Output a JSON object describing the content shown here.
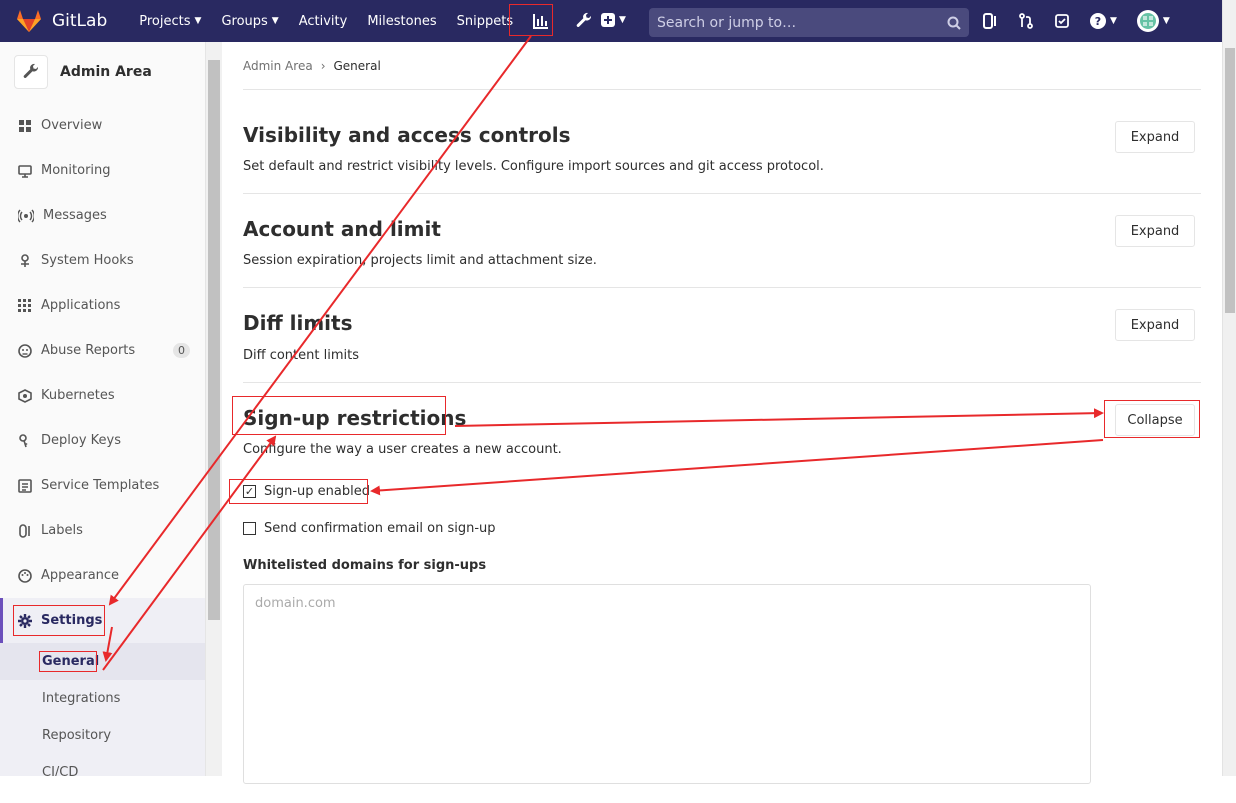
{
  "topbar": {
    "brand": "GitLab",
    "nav": [
      "Projects",
      "Groups",
      "Activity",
      "Milestones",
      "Snippets"
    ],
    "search_placeholder": "Search or jump to…",
    "bg_color": "#292961"
  },
  "sidebar": {
    "title": "Admin Area",
    "items": [
      {
        "label": "Overview",
        "icon": "overview-icon"
      },
      {
        "label": "Monitoring",
        "icon": "monitor-icon"
      },
      {
        "label": "Messages",
        "icon": "broadcast-icon"
      },
      {
        "label": "System Hooks",
        "icon": "hook-icon"
      },
      {
        "label": "Applications",
        "icon": "grid-icon"
      },
      {
        "label": "Abuse Reports",
        "icon": "abuse-icon",
        "badge": "0"
      },
      {
        "label": "Kubernetes",
        "icon": "kubernetes-icon"
      },
      {
        "label": "Deploy Keys",
        "icon": "key-icon"
      },
      {
        "label": "Service Templates",
        "icon": "template-icon"
      },
      {
        "label": "Labels",
        "icon": "label-icon"
      },
      {
        "label": "Appearance",
        "icon": "palette-icon"
      },
      {
        "label": "Settings",
        "icon": "gear-icon"
      }
    ],
    "sub_items": [
      "General",
      "Integrations",
      "Repository",
      "CI/CD"
    ]
  },
  "breadcrumb": {
    "parent": "Admin Area",
    "current": "General"
  },
  "sections": [
    {
      "title": "Visibility and access controls",
      "desc": "Set default and restrict visibility levels. Configure import sources and git access protocol.",
      "button": "Expand"
    },
    {
      "title": "Account and limit",
      "desc": "Session expiration, projects limit and attachment size.",
      "button": "Expand"
    },
    {
      "title": "Diff limits",
      "desc": "Diff content limits",
      "button": "Expand"
    },
    {
      "title": "Sign-up restrictions",
      "desc": "Configure the way a user creates a new account.",
      "button": "Collapse"
    }
  ],
  "signup": {
    "signup_enabled": "Sign-up enabled",
    "send_confirmation": "Send confirmation email on sign-up",
    "whitelist_label": "Whitelisted domains for sign-ups",
    "whitelist_placeholder": "domain.com"
  },
  "colors": {
    "annotation": "#e8292b",
    "accent": "#6b4fbb"
  }
}
